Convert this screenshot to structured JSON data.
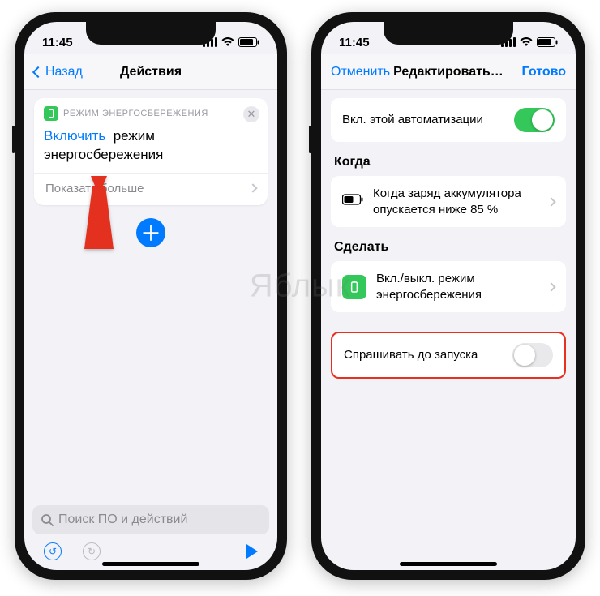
{
  "watermark": "Яблык",
  "left": {
    "statusbar": {
      "time": "11:45"
    },
    "nav": {
      "back": "Назад",
      "title": "Действия"
    },
    "card": {
      "header": "РЕЖИМ ЭНЕРГОСБЕРЕЖЕНИЯ",
      "link_word": "Включить",
      "rest_line1": "режим",
      "rest_line2": "энергосбережения",
      "show_more": "Показать больше"
    },
    "search_placeholder": "Поиск ПО и действий"
  },
  "right": {
    "statusbar": {
      "time": "11:45"
    },
    "nav": {
      "cancel": "Отменить",
      "title": "Редактировать автомати…",
      "done": "Готово"
    },
    "row_enable": "Вкл. этой автоматизации",
    "section_when": "Когда",
    "when_text": "Когда заряд аккумулятора опускается ниже 85 %",
    "section_do": "Сделать",
    "do_text": "Вкл./выкл. режим энергосбережения",
    "ask_before": "Спрашивать до запуска"
  }
}
